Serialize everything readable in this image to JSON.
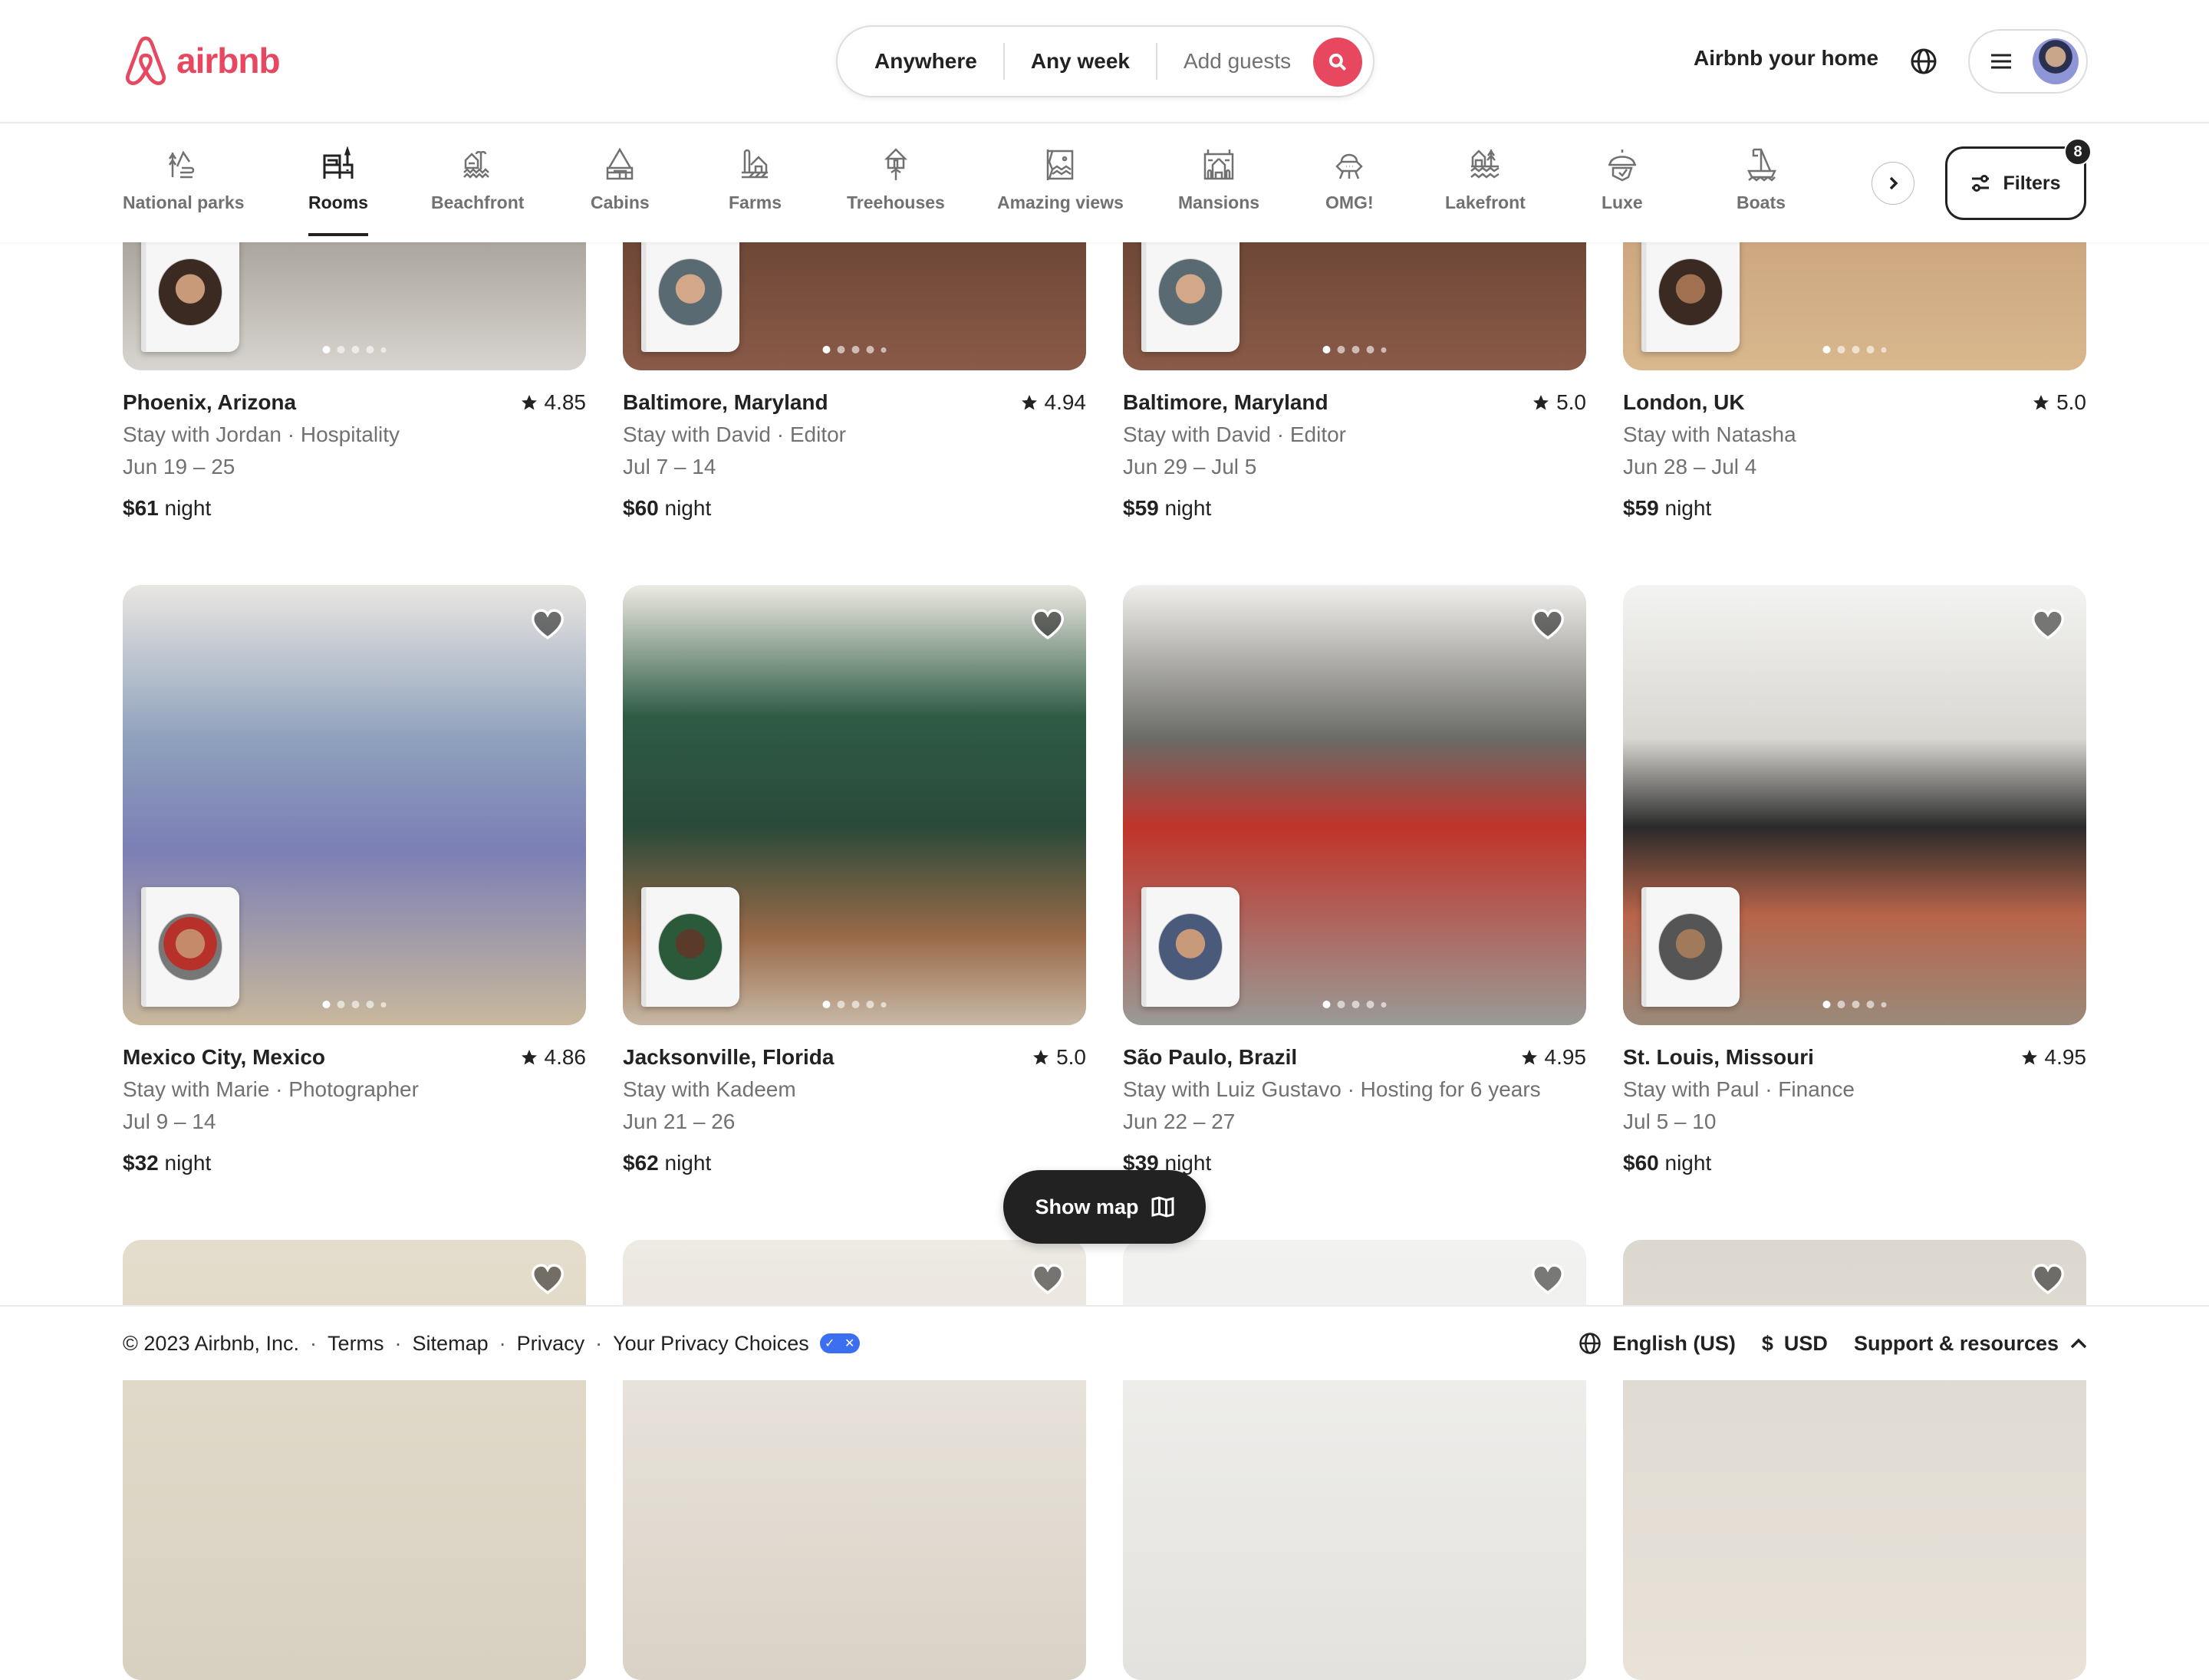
{
  "header": {
    "brand": "airbnb",
    "brand_color": "#e8485f",
    "search": {
      "location": "Anywhere",
      "dates": "Any week",
      "guests_placeholder": "Add guests"
    },
    "host_link": "Airbnb your home"
  },
  "categories": {
    "items": [
      {
        "label": "National parks",
        "icon": "national-parks-icon"
      },
      {
        "label": "Rooms",
        "icon": "rooms-icon",
        "active": true
      },
      {
        "label": "Beachfront",
        "icon": "beachfront-icon"
      },
      {
        "label": "Cabins",
        "icon": "cabins-icon"
      },
      {
        "label": "Farms",
        "icon": "farms-icon"
      },
      {
        "label": "Treehouses",
        "icon": "treehouses-icon"
      },
      {
        "label": "Amazing views",
        "icon": "amazing-views-icon"
      },
      {
        "label": "Mansions",
        "icon": "mansions-icon"
      },
      {
        "label": "OMG!",
        "icon": "omg-icon"
      },
      {
        "label": "Lakefront",
        "icon": "lakefront-icon"
      },
      {
        "label": "Luxe",
        "icon": "luxe-icon"
      },
      {
        "label": "Boats",
        "icon": "boats-icon"
      }
    ],
    "filters_label": "Filters",
    "filters_count": "8"
  },
  "listings": [
    {
      "title": "Phoenix, Arizona",
      "rating": "4.85",
      "host": "Stay with Jordan · Hospitality",
      "dates": "Jun 19 – 25",
      "price": "$61",
      "unit": "night"
    },
    {
      "title": "Baltimore, Maryland",
      "rating": "4.94",
      "host": "Stay with David · Editor",
      "dates": "Jul 7 – 14",
      "price": "$60",
      "unit": "night"
    },
    {
      "title": "Baltimore, Maryland",
      "rating": "5.0",
      "host": "Stay with David · Editor",
      "dates": "Jun 29 – Jul 5",
      "price": "$59",
      "unit": "night"
    },
    {
      "title": "London, UK",
      "rating": "5.0",
      "host": "Stay with Natasha",
      "dates": "Jun 28 – Jul 4",
      "price": "$59",
      "unit": "night"
    },
    {
      "title": "Mexico City, Mexico",
      "rating": "4.86",
      "host": "Stay with Marie · Photographer",
      "dates": "Jul 9 – 14",
      "price": "$32",
      "unit": "night"
    },
    {
      "title": "Jacksonville, Florida",
      "rating": "5.0",
      "host": "Stay with Kadeem",
      "dates": "Jun 21 – 26",
      "price": "$62",
      "unit": "night"
    },
    {
      "title": "São Paulo, Brazil",
      "rating": "4.95",
      "host": "Stay with Luiz Gustavo · Hosting for 6 years",
      "dates": "Jun 22 – 27",
      "price": "$39",
      "unit": "night"
    },
    {
      "title": "St. Louis, Missouri",
      "rating": "4.95",
      "host": "Stay with Paul · Finance",
      "dates": "Jul 5 – 10",
      "price": "$60",
      "unit": "night"
    }
  ],
  "show_map_label": "Show map",
  "footer": {
    "copyright": "© 2023 Airbnb, Inc.",
    "links": [
      "Terms",
      "Sitemap",
      "Privacy",
      "Your Privacy Choices"
    ],
    "language": "English (US)",
    "currency_symbol": "$",
    "currency": "USD",
    "support": "Support & resources"
  }
}
